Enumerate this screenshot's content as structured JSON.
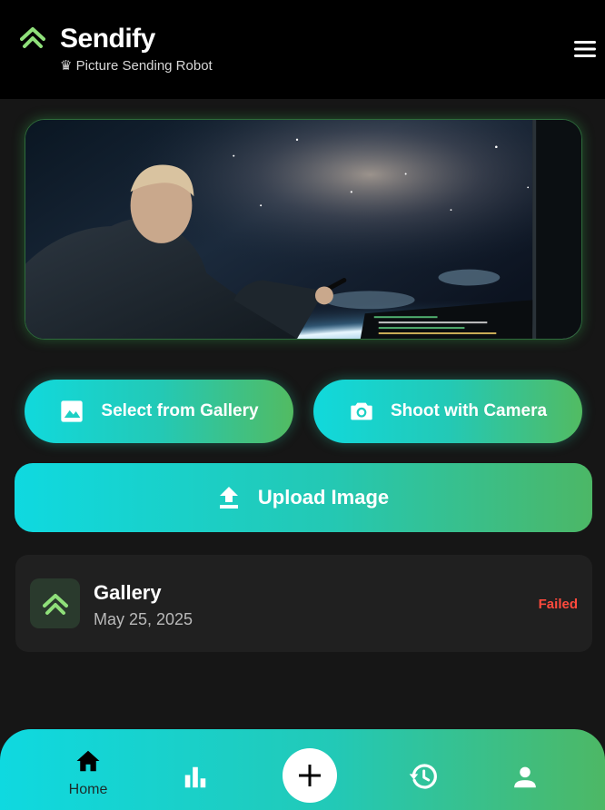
{
  "app": {
    "title": "Sendify",
    "subtitle": "♛ Picture Sending Robot",
    "accent": "#8fe07a",
    "icons": {
      "logo": "sendify-logo-icon",
      "menu": "hamburger-menu-icon"
    }
  },
  "hero": {
    "image": "astronaut-viewing-earth-from-space-station"
  },
  "actions": {
    "gallery": {
      "label": "Select from Gallery",
      "icon": "image-icon"
    },
    "camera": {
      "label": "Shoot with Camera",
      "icon": "camera-icon"
    },
    "upload": {
      "label": "Upload Image",
      "icon": "upload-icon"
    },
    "gradient": [
      "#11d9dc",
      "#23c9b6",
      "#52bb62"
    ]
  },
  "recent": [
    {
      "title": "Gallery",
      "date": "May 25, 2025",
      "status": "Failed",
      "status_color": "#ff4a3d"
    }
  ],
  "nav": {
    "home_label": "Home",
    "items": [
      "home-icon",
      "bar-chart-icon",
      "add-icon",
      "history-icon",
      "person-icon"
    ]
  }
}
